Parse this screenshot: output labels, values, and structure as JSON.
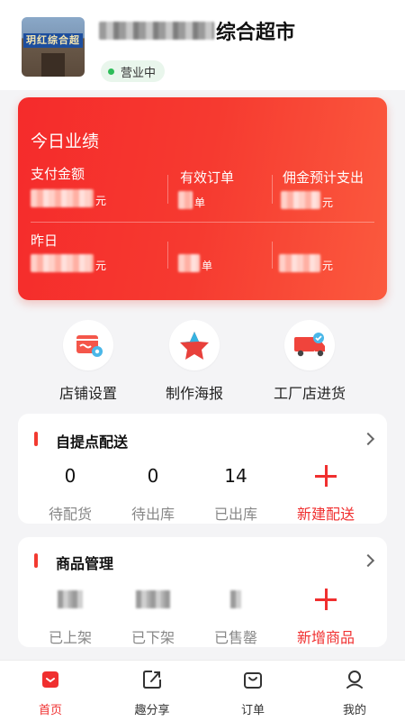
{
  "header": {
    "store_photo_sign": "玥红综合超",
    "store_name": "综合超市",
    "status": "营业中"
  },
  "performance": {
    "title": "今日业绩",
    "pay_amount_label": "支付金额",
    "valid_orders_label": "有效订单",
    "commission_label": "佣金预计支出",
    "yesterday_label": "昨日",
    "unit_yuan": "元",
    "unit_order": "单"
  },
  "quick_actions": [
    {
      "label": "店铺设置",
      "icon": "shop-settings-icon"
    },
    {
      "label": "制作海报",
      "icon": "poster-star-icon"
    },
    {
      "label": "工厂店进货",
      "icon": "delivery-truck-icon"
    }
  ],
  "pickup": {
    "title": "自提点配送",
    "stats": [
      {
        "value": "0",
        "label": "待配货"
      },
      {
        "value": "0",
        "label": "待出库"
      },
      {
        "value": "14",
        "label": "已出库"
      }
    ],
    "add_label": "新建配送"
  },
  "goods": {
    "title": "商品管理",
    "stats": [
      {
        "label": "已上架"
      },
      {
        "label": "已下架"
      },
      {
        "label": "已售罄"
      }
    ],
    "add_label": "新增商品"
  },
  "tabbar": [
    {
      "label": "首页",
      "icon": "home-icon",
      "active": true
    },
    {
      "label": "趣分享",
      "icon": "share-icon",
      "active": false
    },
    {
      "label": "订单",
      "icon": "order-bag-icon",
      "active": false
    },
    {
      "label": "我的",
      "icon": "profile-icon",
      "active": false
    }
  ],
  "colors": {
    "accent": "#f02f2f",
    "card_gradient_start": "#f52b2b",
    "card_gradient_end": "#fb5a3e",
    "status_green": "#2ebd59"
  }
}
